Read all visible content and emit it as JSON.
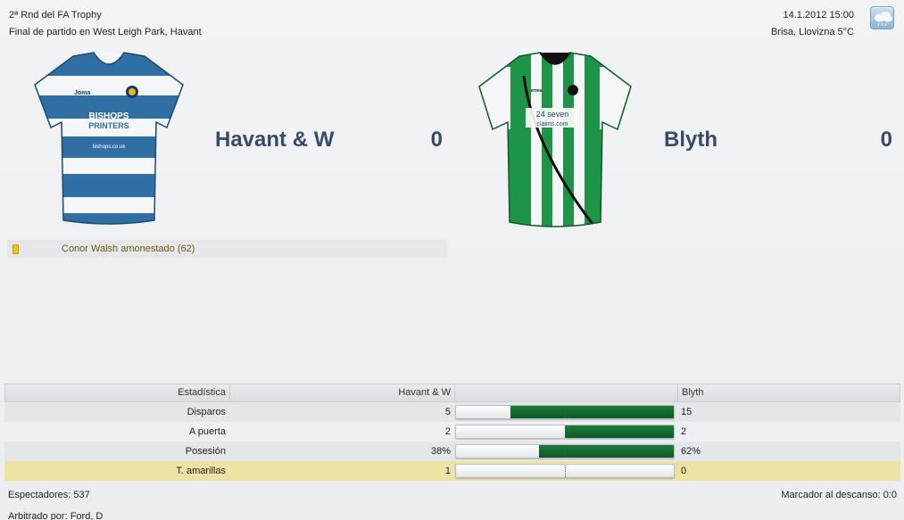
{
  "header": {
    "competition": "2ª Rnd del FA Trophy",
    "match_info": "Final de partido en West Leigh Park, Havant",
    "datetime": "14.1.2012 15:00",
    "weather": "Brisa, Llovizna 5°C",
    "weather_icon": "rain-cloud-icon"
  },
  "home": {
    "name": "Havant & W",
    "score": "0",
    "kit_colors": {
      "primary": "#2f6fa3",
      "secondary": "#ffffff"
    },
    "sponsor_line1": "BISHOPS",
    "sponsor_line2": "PRINTERS",
    "sponsor_url": "bishops.co.uk",
    "kit_brand": "Joma"
  },
  "away": {
    "name": "Blyth",
    "score": "0",
    "kit_colors": {
      "primary": "#1e9449",
      "secondary": "#ffffff"
    },
    "sponsor_line1": "24 seven",
    "sponsor_line2": "claims.com",
    "kit_brand": "errea"
  },
  "events": [
    {
      "type": "yellow-card",
      "text": "Conor Walsh amonestado (62)"
    }
  ],
  "stats": {
    "headers": {
      "stat": "Estadística",
      "home": "Havant & W",
      "away": "Blyth"
    },
    "rows": [
      {
        "label": "Disparos",
        "home": "5",
        "away": "15",
        "away_share": 0.75
      },
      {
        "label": "A puerta",
        "home": "2",
        "away": "2",
        "away_share": 0.5
      },
      {
        "label": "Posesión",
        "home": "38%",
        "away": "62%",
        "away_share": 0.62
      },
      {
        "label": "T. amarillas",
        "home": "1",
        "away": "0",
        "away_share": 0.0
      }
    ]
  },
  "footer": {
    "attendance": "Espectadores: 537",
    "referee": "Arbitrado por: Ford, D",
    "halftime": "Marcador al descanso: 0:0"
  }
}
